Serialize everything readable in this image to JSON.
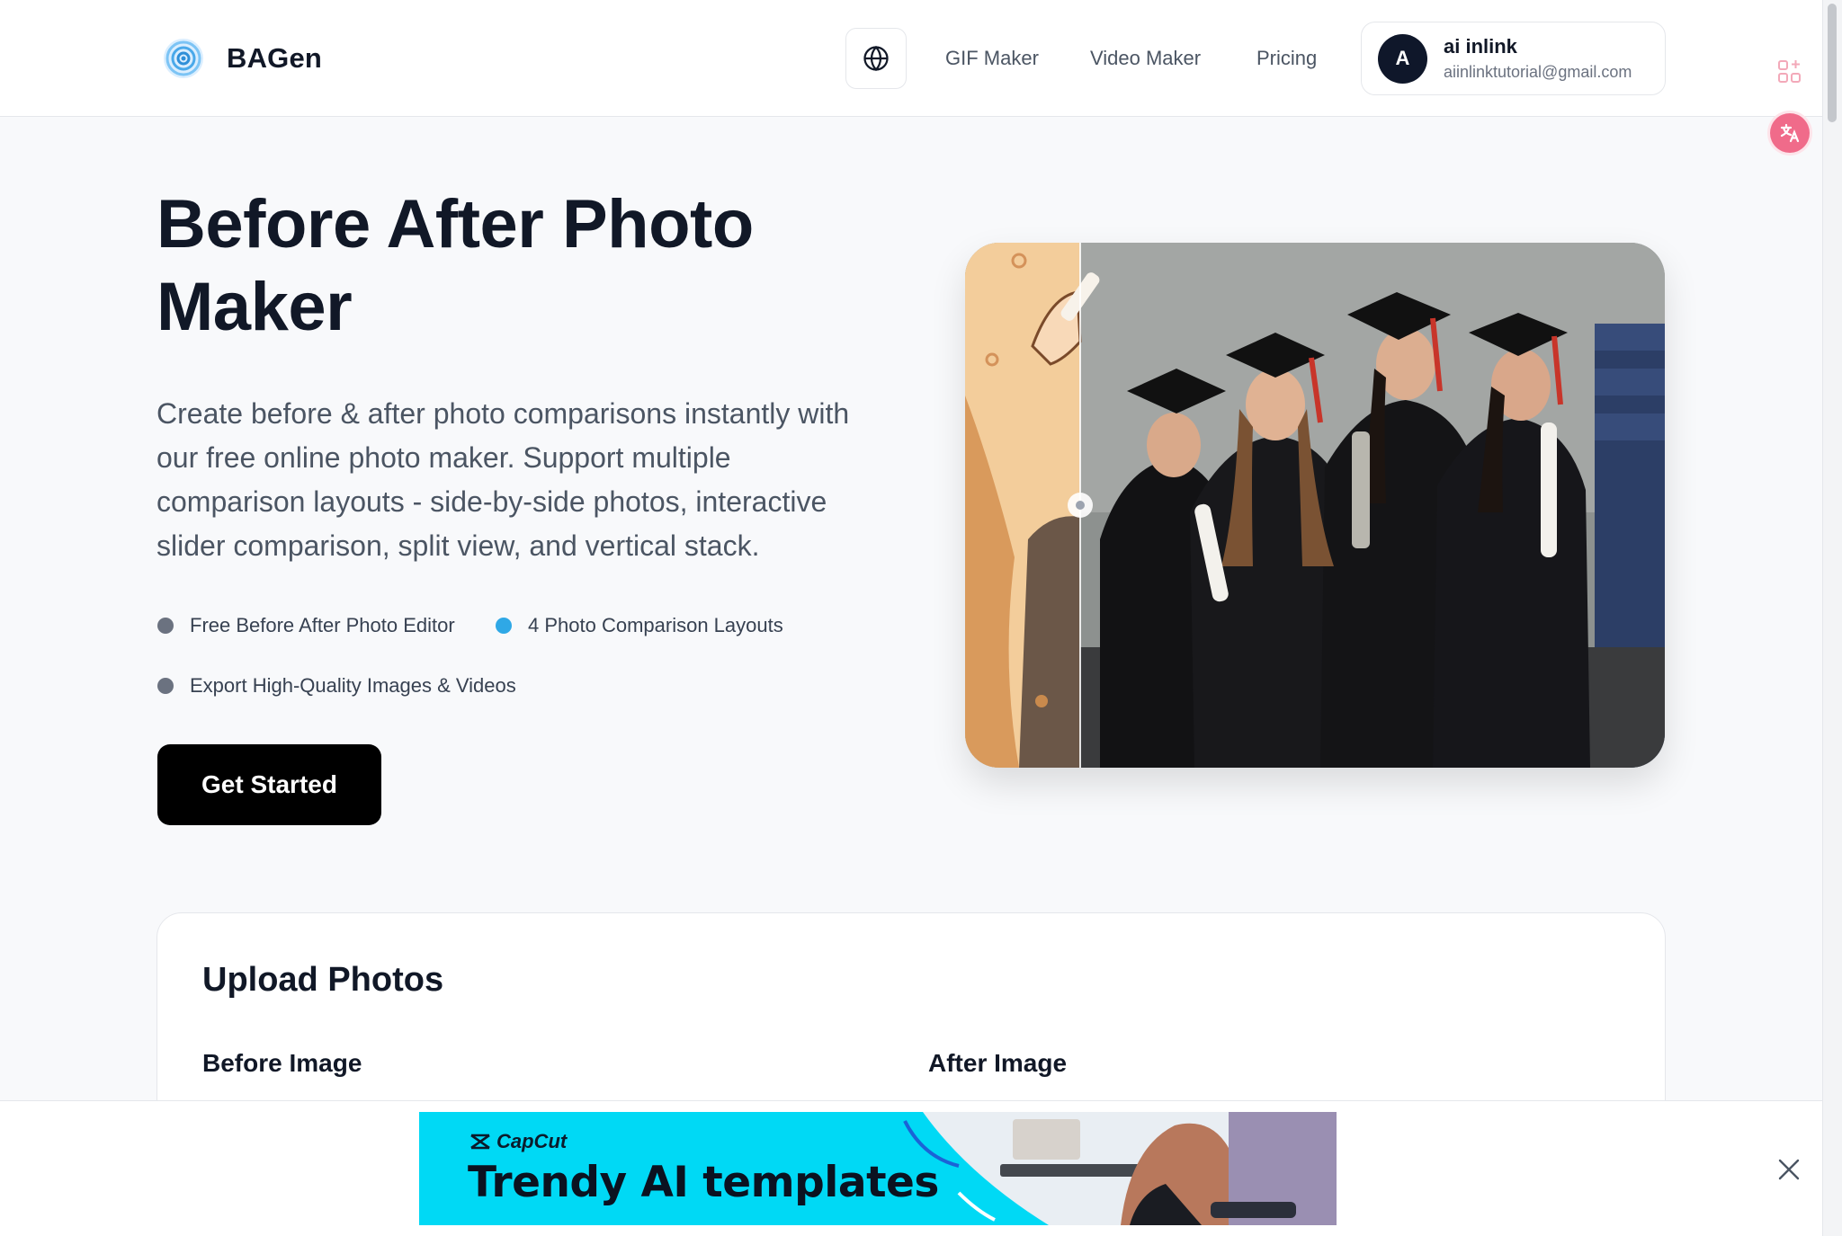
{
  "header": {
    "brand": "BAGen",
    "nav": {
      "gif_maker": "GIF Maker",
      "video_maker": "Video Maker",
      "pricing": "Pricing"
    },
    "user": {
      "avatar_initial": "A",
      "name": "ai inlink",
      "email": "aiinlinktutorial@gmail.com"
    },
    "icons": [
      "logo-icon",
      "globe-icon",
      "apps-sparkle-icon",
      "translate-icon"
    ]
  },
  "hero": {
    "title": "Before After Photo Maker",
    "description": "Create before & after photo comparisons instantly with our free online photo maker. Support multiple comparison layouts - side-by-side photos, interactive slider comparison, split view, and vertical stack.",
    "features": [
      {
        "label": "Free Before After Photo Editor",
        "dot_color": "#6b7280"
      },
      {
        "label": "4 Photo Comparison Layouts",
        "dot_color": "#2fa8e6"
      },
      {
        "label": "Export High-Quality Images & Videos",
        "dot_color": "#6b7280"
      }
    ],
    "cta_label": "Get Started"
  },
  "upload": {
    "title": "Upload Photos",
    "before_label": "Before Image",
    "after_label": "After Image"
  },
  "ad": {
    "brand": "CapCut",
    "headline": "Trendy AI templates",
    "background_color": "#00d9f5"
  },
  "colors": {
    "page_bg": "#f8f9fb",
    "primary_text": "#111827",
    "cta_bg": "#000000",
    "accent_blue": "#2fa8e6"
  }
}
